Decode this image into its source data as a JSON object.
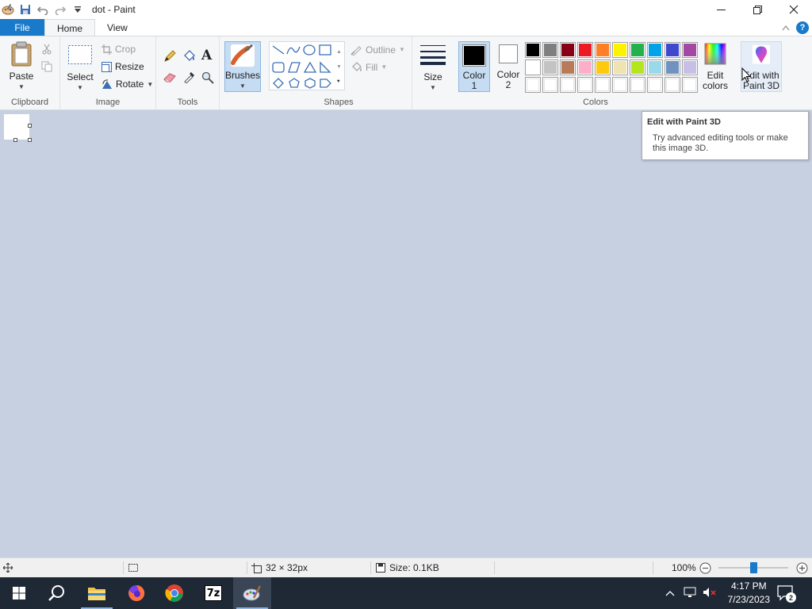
{
  "window": {
    "title": "dot - Paint"
  },
  "tabs": {
    "file": "File",
    "home": "Home",
    "view": "View"
  },
  "clipboard": {
    "paste": "Paste",
    "label": "Clipboard"
  },
  "image": {
    "select": "Select",
    "crop": "Crop",
    "resize": "Resize",
    "rotate": "Rotate",
    "label": "Image"
  },
  "tools": {
    "label": "Tools",
    "text_tool": "A"
  },
  "brushes": {
    "label": "Brushes"
  },
  "shapes": {
    "outline": "Outline",
    "fill": "Fill",
    "label": "Shapes"
  },
  "size": {
    "label": "Size"
  },
  "colors": {
    "color1_line1": "Color",
    "color1_line2": "1",
    "color2_line1": "Color",
    "color2_line2": "2",
    "edit_line1": "Edit",
    "edit_line2": "colors",
    "paint3d_line1": "Edit with",
    "paint3d_line2": "Paint 3D",
    "label": "Colors",
    "color1_value": "#000000",
    "color2_value": "#ffffff",
    "palette_row1": [
      "#000000",
      "#7f7f7f",
      "#880015",
      "#ed1c24",
      "#ff7f27",
      "#fff200",
      "#22b14c",
      "#00a2e8",
      "#3f48cc",
      "#a349a4"
    ],
    "palette_row2": [
      "#ffffff",
      "#c3c3c3",
      "#b97a57",
      "#ffaec9",
      "#ffc90e",
      "#efe4b0",
      "#b5e61d",
      "#99d9ea",
      "#7092be",
      "#c8bfe7"
    ],
    "palette_row3": [
      "#ffffff",
      "#ffffff",
      "#ffffff",
      "#ffffff",
      "#ffffff",
      "#ffffff",
      "#ffffff",
      "#ffffff",
      "#ffffff",
      "#ffffff"
    ]
  },
  "tooltip": {
    "title": "Edit with Paint 3D",
    "desc_line1": "Try advanced editing tools or make",
    "desc_line2": "this image 3D."
  },
  "status": {
    "dimensions": "32 × 32px",
    "size": "Size: 0.1KB",
    "zoom": "100%",
    "zoom_level": 0.5
  },
  "taskbar": {
    "time": "4:17 PM",
    "date": "7/23/2023",
    "notifications": "2",
    "sevenzip": "7z"
  }
}
